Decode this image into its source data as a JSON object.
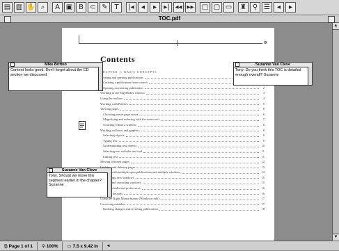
{
  "toolbar": {
    "buttons": [
      {
        "name": "select-tool-icon",
        "glyph": "▤"
      },
      {
        "name": "page-icon",
        "glyph": "▥"
      },
      {
        "name": "hand-tool-icon",
        "glyph": "✋"
      },
      {
        "name": "zoom-tool-icon",
        "glyph": "⌕"
      },
      {
        "name": "text-select-icon",
        "glyph": "A"
      },
      {
        "name": "crop-icon",
        "glyph": "▣"
      },
      {
        "name": "thumbnails-icon",
        "glyph": "B"
      },
      {
        "name": "link-icon",
        "glyph": "⊂"
      },
      {
        "name": "note-tool-icon",
        "glyph": "✎"
      },
      {
        "name": "type-tool-icon",
        "glyph": "T"
      },
      {
        "name": "first-page-icon",
        "glyph": "|◂"
      },
      {
        "name": "prev-page-icon",
        "glyph": "◂"
      },
      {
        "name": "next-page-icon",
        "glyph": "▸"
      },
      {
        "name": "last-page-icon",
        "glyph": "▸|"
      },
      {
        "name": "go-back-icon",
        "glyph": "◂◂"
      },
      {
        "name": "go-forward-icon",
        "glyph": "▸▸"
      },
      {
        "name": "actual-size-icon",
        "glyph": "□"
      },
      {
        "name": "fit-page-icon",
        "glyph": "▢"
      },
      {
        "name": "fit-width-icon",
        "glyph": "▭"
      },
      {
        "name": "find-icon",
        "glyph": "♜"
      },
      {
        "name": "search-icon",
        "glyph": "⚲"
      },
      {
        "name": "search-results-icon",
        "glyph": "☰"
      },
      {
        "name": "search-prev-icon",
        "glyph": "◂"
      },
      {
        "name": "search-next-icon",
        "glyph": "▸"
      }
    ]
  },
  "window": {
    "title": "TOC.pdf"
  },
  "document": {
    "heading": "Contents",
    "entries": [
      {
        "text": "CHAPTER 1: BASIC CONCEPTS",
        "page": "",
        "level": "chap"
      },
      {
        "text": "Creating and opening publications",
        "page": "1",
        "level": "l0"
      },
      {
        "text": "Creating a publication from scratch",
        "page": "1",
        "level": "l1"
      },
      {
        "text": "Opening an existing publication",
        "page": "2",
        "level": "l1"
      },
      {
        "text": "Working in the PageMaker window",
        "page": "3",
        "level": "l0"
      },
      {
        "text": "Using the toolbox",
        "page": "4",
        "level": "l0"
      },
      {
        "text": "Working with Palettes",
        "page": "5",
        "level": "l0"
      },
      {
        "text": "Viewing pages",
        "page": "6",
        "level": "l0"
      },
      {
        "text": "Choosing preset page views",
        "page": "6",
        "level": "l1"
      },
      {
        "text": "Magnifying and reducing with the zoom tool",
        "page": "7",
        "level": "l1"
      },
      {
        "text": "Scrolling within a window",
        "page": "8",
        "level": "l1"
      },
      {
        "text": "Working with text and graphics",
        "page": "8",
        "level": "l0"
      },
      {
        "text": "Selecting objects",
        "page": "9",
        "level": "l1"
      },
      {
        "text": "Typing text",
        "page": "9",
        "level": "l1"
      },
      {
        "text": "Understanding text objects",
        "page": "10",
        "level": "l1"
      },
      {
        "text": "Selecting text with the text tool",
        "page": "11",
        "level": "l1"
      },
      {
        "text": "Editing text",
        "page": "11",
        "level": "l1"
      },
      {
        "text": "Moving between pages",
        "page": "12",
        "level": "l0"
      },
      {
        "text": "Undoing and deleting pages",
        "page": "13",
        "level": "l0"
      },
      {
        "text": "Working with multiple open publications and multiple windows",
        "page": "14",
        "level": "l0"
      },
      {
        "text": "Arranging new windows",
        "page": "15",
        "level": "l1"
      },
      {
        "text": "Tiling and cascading windows",
        "page": "15",
        "level": "l1"
      },
      {
        "text": "Setting defaults and preferences",
        "page": "16",
        "level": "l0"
      },
      {
        "text": "Setting defaults",
        "page": "16",
        "level": "l1"
      },
      {
        "text": "Using the Right Mouse button (Windows only)",
        "page": "17",
        "level": "l0"
      },
      {
        "text": "Correcting mistakes",
        "page": "17",
        "level": "l0"
      },
      {
        "text": "Undoing changes and reverting publications",
        "page": "18",
        "level": "l1"
      }
    ]
  },
  "notes": {
    "mike": {
      "author": "Mike Britton",
      "text": "Content looks good. Don't forget about the CD section we discussed."
    },
    "suzanne_top": {
      "author": "Suzanne Van Cleve",
      "text": "Tony: Do you think this TOC is detailed enough overall? Suzanne"
    },
    "suzanne_bottom": {
      "author": "Suzanne Van Cleve",
      "text": "Tony: Should we move this segment earlier in the chapter? Suzanne"
    }
  },
  "status": {
    "page": "Page 1 of 1",
    "zoom": "100%",
    "size": "7.5 x 9.42 in"
  }
}
